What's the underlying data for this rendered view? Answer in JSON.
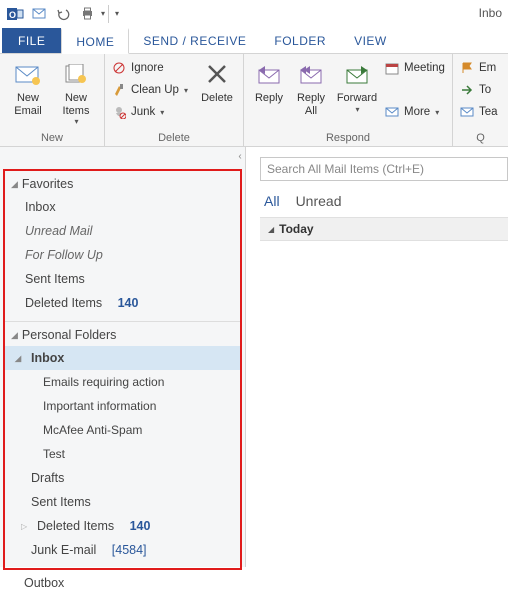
{
  "titlebar": {
    "title": "Inbo"
  },
  "tabs": {
    "file": "FILE",
    "home": "HOME",
    "send": "SEND / RECEIVE",
    "folder": "FOLDER",
    "view": "VIEW"
  },
  "ribbon": {
    "new": {
      "label": "New",
      "new_email": "New\nEmail",
      "new_items": "New\nItems"
    },
    "delete_group": {
      "label": "Delete",
      "ignore": "Ignore",
      "cleanup": "Clean Up",
      "junk": "Junk",
      "delete": "Delete"
    },
    "respond": {
      "label": "Respond",
      "reply": "Reply",
      "reply_all": "Reply\nAll",
      "forward": "Forward",
      "meeting": "Meeting",
      "more": "More"
    },
    "quick": {
      "label": "Q",
      "em": "Em",
      "to": "To",
      "tea": "Tea"
    }
  },
  "nav": {
    "favorites": {
      "header": "Favorites",
      "items": [
        {
          "label": "Inbox"
        },
        {
          "label": "Unread Mail",
          "italic": true
        },
        {
          "label": "For Follow Up",
          "italic": true
        },
        {
          "label": "Sent Items"
        },
        {
          "label": "Deleted Items",
          "count": "140"
        }
      ]
    },
    "personal": {
      "header": "Personal Folders",
      "inbox": {
        "label": "Inbox"
      },
      "subs": [
        {
          "label": "Emails requiring action"
        },
        {
          "label": "Important information"
        },
        {
          "label": "McAfee Anti-Spam"
        },
        {
          "label": "Test"
        }
      ],
      "drafts": "Drafts",
      "sent": "Sent Items",
      "deleted": {
        "label": "Deleted Items",
        "count": "140"
      },
      "junk": {
        "label": "Junk E-mail",
        "count": "[4584]"
      }
    },
    "outbox": "Outbox"
  },
  "read": {
    "search_placeholder": "Search All Mail Items (Ctrl+E)",
    "filter_all": "All",
    "filter_unread": "Unread",
    "today": "Today"
  }
}
